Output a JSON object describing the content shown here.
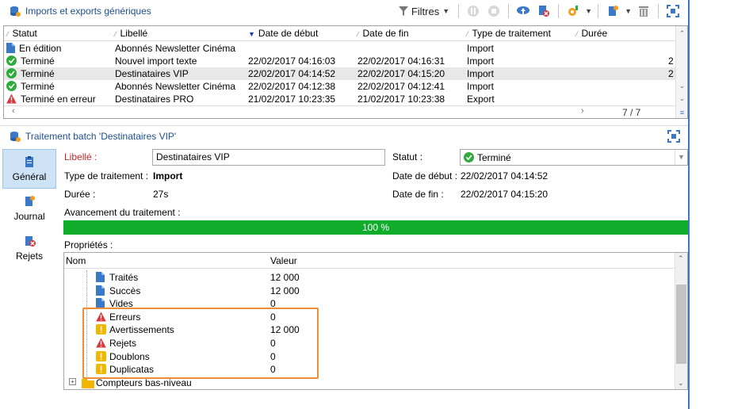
{
  "top_panel": {
    "title": "Imports et exports génériques",
    "filter_label": "Filtres"
  },
  "grid": {
    "columns": [
      "Statut",
      "Libellé",
      "Date de début",
      "Date de fin",
      "Type de traitement",
      "Durée"
    ],
    "rows": [
      {
        "status": "En édition",
        "status_icon": "document-icon",
        "label": "Abonnés Newsletter Cinéma",
        "start": "",
        "end": "",
        "type": "Import",
        "duration": ""
      },
      {
        "status": "Terminé",
        "status_icon": "check-icon",
        "label": "Nouvel import texte",
        "start": "22/02/2017 04:16:03",
        "end": "22/02/2017 04:16:31",
        "type": "Import",
        "duration": "2"
      },
      {
        "status": "Terminé",
        "status_icon": "check-icon",
        "label": "Destinataires VIP",
        "start": "22/02/2017 04:14:52",
        "end": "22/02/2017 04:15:20",
        "type": "Import",
        "duration": "2"
      },
      {
        "status": "Terminé",
        "status_icon": "check-icon",
        "label": "Abonnés Newsletter Cinéma",
        "start": "22/02/2017 04:12:38",
        "end": "22/02/2017 04:12:41",
        "type": "Import",
        "duration": ""
      },
      {
        "status": "Terminé en erreur",
        "status_icon": "warning-icon",
        "label": "Destinataires PRO",
        "start": "21/02/2017 10:23:35",
        "end": "21/02/2017 10:23:38",
        "type": "Export",
        "duration": ""
      }
    ],
    "counter": "7 / 7"
  },
  "batch": {
    "title": "Traitement batch 'Destinataires VIP'",
    "sidebar": [
      {
        "label": "Général",
        "icon": "clipboard-icon"
      },
      {
        "label": "Journal",
        "icon": "journal-icon"
      },
      {
        "label": "Rejets",
        "icon": "reject-icon"
      }
    ],
    "label_caption": "Libellé :",
    "label_value": "Destinataires VIP",
    "status_caption": "Statut :",
    "status_value": "Terminé",
    "type_caption": "Type de traitement :",
    "type_value": "Import",
    "start_caption": "Date de début :",
    "start_value": "22/02/2017 04:14:52",
    "duration_caption": "Durée :",
    "duration_value": "27s",
    "end_caption": "Date de fin :",
    "end_value": "22/02/2017 04:15:20",
    "progress_caption": "Avancement du traitement :",
    "progress_value": 100,
    "progress_text": "100 %",
    "properties_caption": "Propriétés :",
    "tree_columns": [
      "Nom",
      "Valeur"
    ],
    "tree_rows": [
      {
        "name": "Traités",
        "value": "12 000",
        "icon": "document-icon"
      },
      {
        "name": "Succès",
        "value": "12 000",
        "icon": "document-icon"
      },
      {
        "name": "Vides",
        "value": "0",
        "icon": "document-icon"
      },
      {
        "name": "Erreurs",
        "value": "0",
        "icon": "error-triangle-icon"
      },
      {
        "name": "Avertissements",
        "value": "12 000",
        "icon": "warning-exclamation-icon"
      },
      {
        "name": "Rejets",
        "value": "0",
        "icon": "error-triangle-icon"
      },
      {
        "name": "Doublons",
        "value": "0",
        "icon": "warning-exclamation-icon"
      },
      {
        "name": "Duplicatas",
        "value": "0",
        "icon": "warning-exclamation-icon"
      }
    ],
    "tree_folder": "Compteurs bas-niveau"
  },
  "colors": {
    "accent": "#1e4e8c",
    "success": "#10ac2c",
    "error": "#d9363e",
    "warning": "#f2b600",
    "highlight": "#f08c32"
  }
}
